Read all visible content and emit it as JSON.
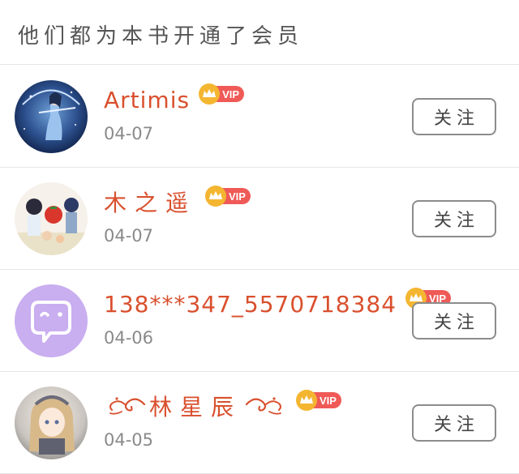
{
  "header": {
    "title": "他们都为本书开通了会员"
  },
  "vip_label": "VIP",
  "follow_label": "关注",
  "colors": {
    "name": "#d9502e",
    "vip_badge": "#ef5a57",
    "crown": "#f4b631",
    "avatar_purple": "#c9aef0"
  },
  "members": [
    {
      "name": "Artimis",
      "date": "04-07",
      "avatar_icon": "avatar-archer-illustration"
    },
    {
      "name": "木之遥",
      "date": "04-07",
      "avatar_icon": "avatar-anime-group-illustration"
    },
    {
      "name": "138***347_5570718384",
      "date": "04-06",
      "avatar_icon": "chat-bubble-default-icon"
    },
    {
      "name": "林星辰",
      "date": "04-05",
      "avatar_icon": "avatar-anime-girl-illustration"
    }
  ]
}
